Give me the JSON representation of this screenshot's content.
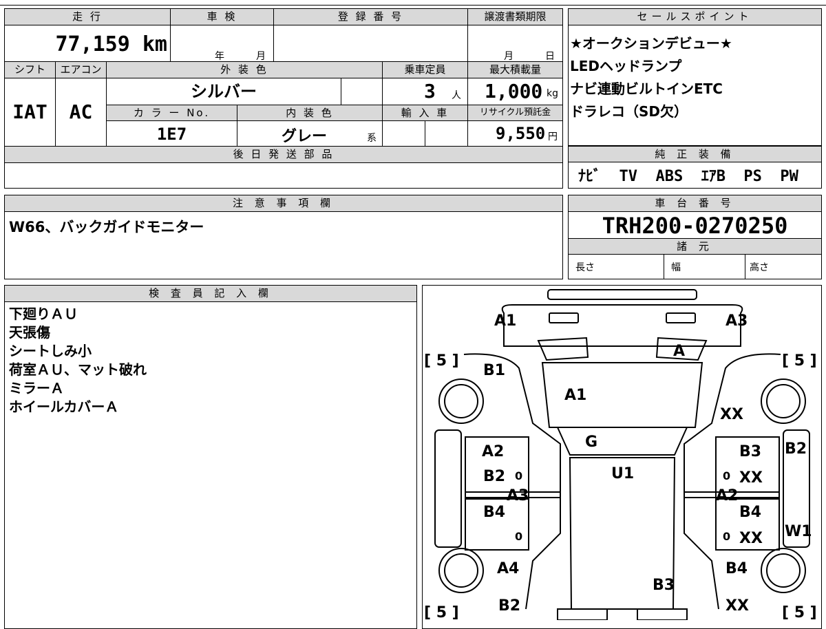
{
  "top_table": {
    "mileage_label": "走 行",
    "mileage": "77,159 km",
    "shaken_label": "車 検",
    "shaken_year_unit": "年",
    "shaken_month_unit": "月",
    "registration_label": "登 録 番 号",
    "transfer_label": "譲渡書類期限",
    "transfer_month_unit": "月",
    "transfer_day_unit": "日",
    "shift_label": "シフト",
    "shift": "IAT",
    "ac_label": "エアコン",
    "ac": "AC",
    "exterior_color_label": "外 装 色",
    "exterior_color": "シルバー",
    "capacity_label": "乗車定員",
    "capacity": "3",
    "capacity_unit": "人",
    "max_load_label": "最大積載量",
    "max_load": "1,000",
    "max_load_unit": "kg",
    "color_no_label": "カ ラ ー No.",
    "color_no": "1E7",
    "interior_color_label": "内 装 色",
    "interior_color": "グレー",
    "interior_color_suffix": "系",
    "import_label": "輸 入 車",
    "recycle_label": "リサイクル預託金",
    "recycle_fee": "9,550",
    "recycle_unit": "円",
    "later_parts_label": "後 日 発 送 部 品"
  },
  "sales_points": {
    "label": "セールスポイント",
    "lines": [
      "★オークションデビュー★",
      "LEDヘッドランプ",
      "ナビ連動ビルトインETC",
      "ドラレコ（SD欠）"
    ]
  },
  "genuine_equipment": {
    "label": "純 正 装 備",
    "items": "ﾅﾋﾞ  TV  ABS  ｴｱB  PS  PW"
  },
  "notes": {
    "label": "注 意 事 項 欄",
    "text": "W66、バックガイドモニター"
  },
  "chassis": {
    "label": "車 台 番 号",
    "number": "TRH200-0270250",
    "specs_label": "諸 元",
    "length_label": "長さ",
    "width_label": "幅",
    "height_label": "高さ"
  },
  "inspector": {
    "label": "検 査 員 記 入 欄",
    "lines": [
      "下廻りＡＵ",
      "天張傷",
      "シートしみ小",
      "荷室ＡＵ、マット破れ",
      "ミラーＡ",
      "ホイールカバーＡ"
    ]
  },
  "diagram": {
    "marks": {
      "front_left": "A1",
      "front_right": "A3",
      "front_glass_right": "A",
      "left_fender": "B1",
      "hood": "A1",
      "right_fender": "XX",
      "windshield": "G",
      "roof": "U1",
      "left_front_door_1": "A2",
      "left_front_door_2": "B2",
      "left_front_door_val": "0",
      "left_rocker": "A3",
      "left_rear_door": "B4",
      "left_rear_door_val": "0",
      "right_front_door_1": "B3",
      "right_front_door_2": "XX",
      "right_front_door_val": "0",
      "right_rocker": "A2",
      "right_rear_door_1": "B4",
      "right_rear_door_2": "XX",
      "right_rear_door_val": "0",
      "right_side_1": "B2",
      "right_side_2": "W1",
      "left_quarter": "A4",
      "right_quarter": "B4",
      "rear_center": "B3",
      "rear_left": "B2",
      "rear_right": "XX",
      "tire_front_left": "[ 5 ]",
      "tire_front_right": "[ 5 ]",
      "tire_rear_left": "[ 5 ]",
      "tire_rear_right": "[ 5 ]"
    }
  }
}
